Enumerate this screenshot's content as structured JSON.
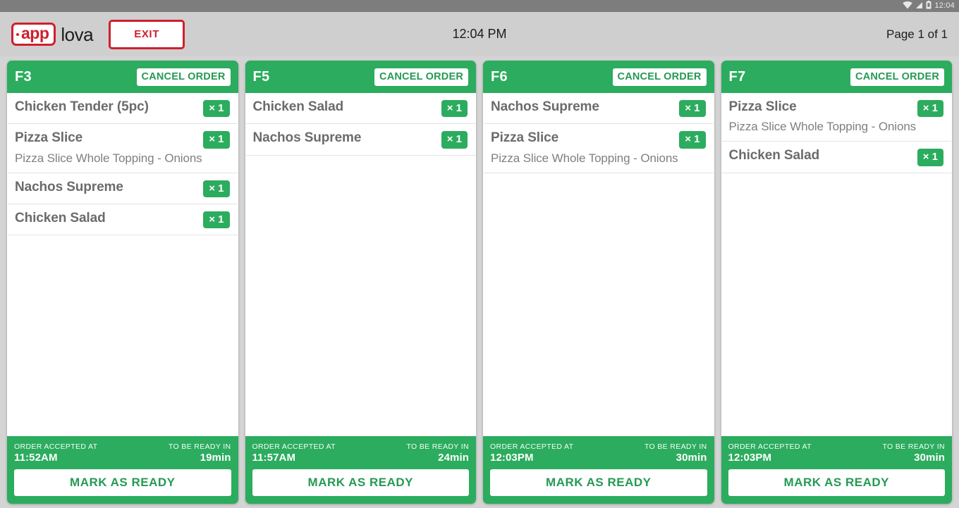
{
  "status_bar": {
    "time": "12:04",
    "icons": [
      "wifi-icon",
      "signal-icon",
      "battery-icon"
    ]
  },
  "header": {
    "logo_mark_text": "app",
    "logo_word_text": "lova",
    "exit_label": "EXIT",
    "clock": "12:04 PM",
    "page_indicator": "Page 1 of 1"
  },
  "theme": {
    "green": "#2cac5e",
    "green_text": "#249a52",
    "red": "#cf1f2e",
    "header_bg": "#cfcfcf",
    "status_bg": "#7d7d7d"
  },
  "labels": {
    "cancel_order": "CANCEL ORDER",
    "mark_as_ready": "MARK AS READY",
    "accepted_at": "ORDER ACCEPTED AT",
    "ready_in": "TO BE READY IN"
  },
  "orders": [
    {
      "table": "F3",
      "accepted_at": "11:52AM",
      "ready_in": "19min",
      "items": [
        {
          "name": "Chicken Tender (5pc)",
          "qty": "× 1",
          "modifier": ""
        },
        {
          "name": "Pizza Slice",
          "qty": "× 1",
          "modifier": "Pizza Slice Whole Topping - Onions"
        },
        {
          "name": "Nachos Supreme",
          "qty": "× 1",
          "modifier": ""
        },
        {
          "name": "Chicken Salad",
          "qty": "× 1",
          "modifier": ""
        }
      ]
    },
    {
      "table": "F5",
      "accepted_at": "11:57AM",
      "ready_in": "24min",
      "items": [
        {
          "name": "Chicken Salad",
          "qty": "× 1",
          "modifier": ""
        },
        {
          "name": "Nachos Supreme",
          "qty": "× 1",
          "modifier": ""
        }
      ]
    },
    {
      "table": "F6",
      "accepted_at": "12:03PM",
      "ready_in": "30min",
      "items": [
        {
          "name": "Nachos Supreme",
          "qty": "× 1",
          "modifier": ""
        },
        {
          "name": "Pizza Slice",
          "qty": "× 1",
          "modifier": "Pizza Slice Whole Topping - Onions"
        }
      ]
    },
    {
      "table": "F7",
      "accepted_at": "12:03PM",
      "ready_in": "30min",
      "items": [
        {
          "name": "Pizza Slice",
          "qty": "× 1",
          "modifier": "Pizza Slice Whole Topping - Onions"
        },
        {
          "name": "Chicken Salad",
          "qty": "× 1",
          "modifier": ""
        }
      ]
    }
  ]
}
